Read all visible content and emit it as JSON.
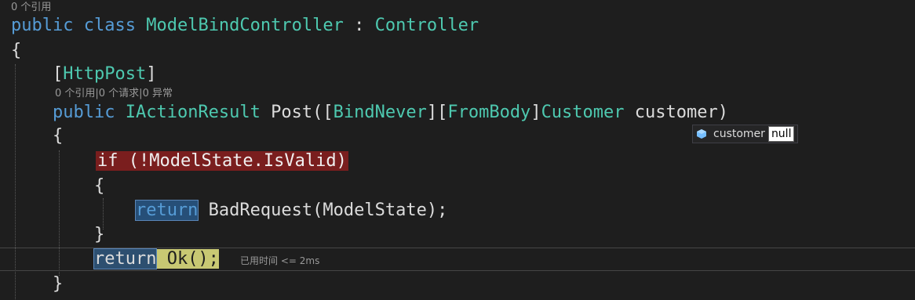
{
  "codelens": {
    "class_refs": "0 个引用",
    "method_refs": "0 个引用|0 个请求|0 异常"
  },
  "code": {
    "kw_public": "public",
    "kw_class": "class",
    "class_name": "ModelBindController",
    "colon": " : ",
    "base_class": "Controller",
    "brace_open": "{",
    "brace_close": "}",
    "attr_open": "[",
    "attr_name": "HttpPost",
    "attr_close": "]",
    "return_type": "IActionResult",
    "method_sig_1": " Post([",
    "attr_bindnever": "BindNever",
    "sig_mid": "][",
    "attr_frombody": "FromBody",
    "sig_close_bracket": "]",
    "param_type": "Customer",
    "param_name": " customer)",
    "if_statement": "if (!ModelState.IsValid)",
    "kw_return": "return",
    "badrequest_call": " BadRequest(ModelState);",
    "ok_call": " Ok();"
  },
  "perf_tip": "已用时间 <= 2ms",
  "datatip": {
    "icon": "variable-icon",
    "name": "customer",
    "value": "null"
  },
  "colors": {
    "keyword": "#569cd6",
    "type": "#4ec9b0",
    "breakpoint_highlight": "#7a1e1e",
    "current_statement": "#c8c873"
  }
}
